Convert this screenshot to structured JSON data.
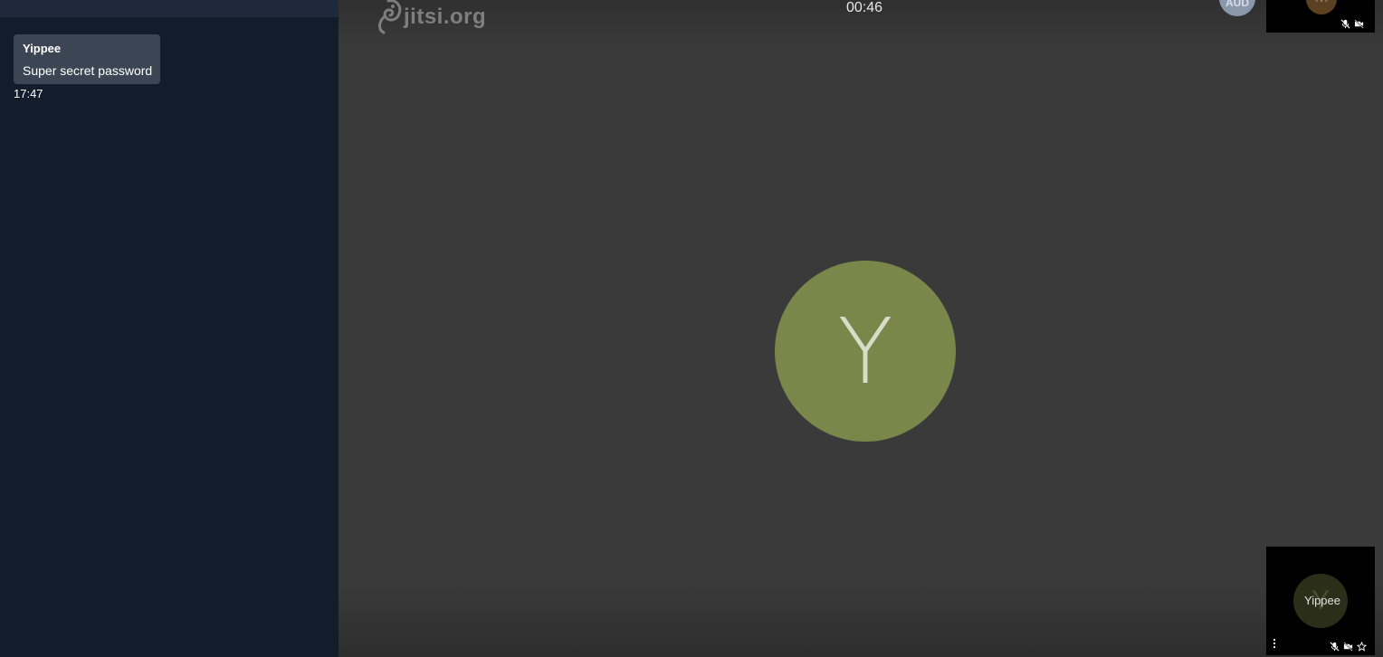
{
  "chat": {
    "messages": [
      {
        "sender": "Yippee",
        "text": "Super secret password",
        "time": "17:47"
      }
    ]
  },
  "stage": {
    "watermark": "jitsi.org",
    "timer": "00:46",
    "top_avatar_initials": "AUD",
    "dominant_initial": "Y",
    "dominant_color": "#7b864a"
  },
  "thumbnails": {
    "remote": {
      "initial": "M",
      "muted": true,
      "video_off": true
    },
    "local": {
      "initial": "Y",
      "name": "Yippee",
      "muted": true,
      "video_off": true
    }
  },
  "icons": [
    "mic-off-icon",
    "video-off-icon",
    "star-icon",
    "more-menu-icon",
    "jitsi-logo-icon"
  ]
}
